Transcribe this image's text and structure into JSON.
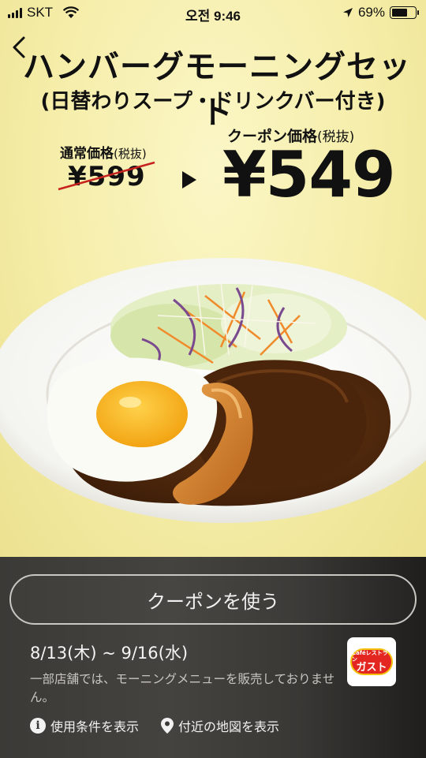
{
  "status_bar": {
    "carrier": "SKT",
    "time": "오전 9:46",
    "battery": "69%",
    "battery_level": 0.69
  },
  "nav": {
    "back_icon": "chevron-left-icon"
  },
  "product": {
    "title": "ハンバーグモーニングセット",
    "subtitle": "(日替わりスープ・ドリンクバー付き)"
  },
  "pricing": {
    "regular_label": "通常価格",
    "regular_label_note": "(税抜)",
    "regular_price": "¥599",
    "coupon_label": "クーポン価格",
    "coupon_label_note": "(税抜)",
    "coupon_price": "¥549"
  },
  "coupon": {
    "use_button": "クーポンを使う",
    "validity": "8/13(木) ~ 9/16(水)",
    "notice": "一部店舗では、モーニングメニューを販売しておりません。"
  },
  "brand": {
    "logo_small": "Caféレストラン",
    "logo_big": "ガスト"
  },
  "links": {
    "terms": "使用条件を表示",
    "map": "付近の地図を表示"
  },
  "colors": {
    "background_yellow": "#f4eea0",
    "panel_dark": "#3c3a37",
    "brand_red": "#e3261f"
  }
}
